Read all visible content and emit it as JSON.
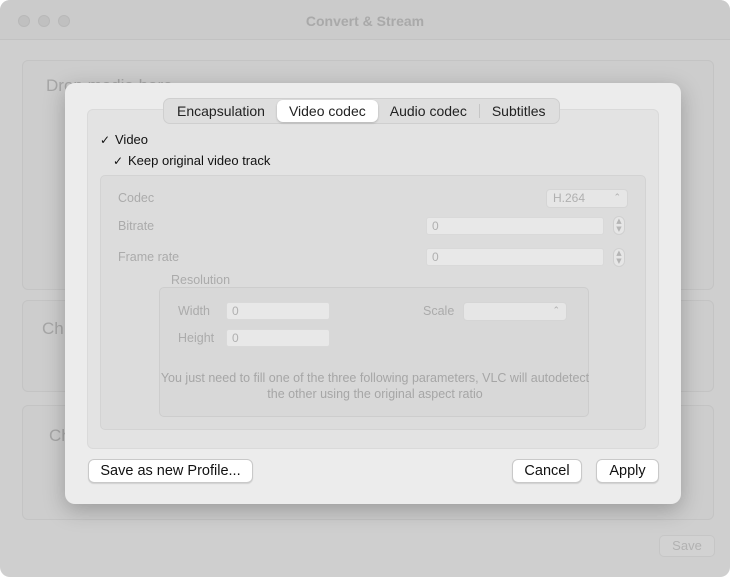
{
  "background_window": {
    "title": "Convert & Stream",
    "drop_text": "Drop media here",
    "section2_text": "Ch",
    "section3_text": "Ch",
    "save_label": "Save"
  },
  "tabs": [
    {
      "label": "Encapsulation",
      "active": false
    },
    {
      "label": "Video codec",
      "active": true
    },
    {
      "label": "Audio codec",
      "active": false
    },
    {
      "label": "Subtitles",
      "active": false
    }
  ],
  "video": {
    "video_checkbox": {
      "label": "Video",
      "checked": true
    },
    "keep_original_checkbox": {
      "label": "Keep original video track",
      "checked": true
    },
    "codec": {
      "label": "Codec",
      "value": "H.264"
    },
    "bitrate": {
      "label": "Bitrate",
      "value": "0"
    },
    "frame_rate": {
      "label": "Frame rate",
      "value": "0"
    },
    "resolution": {
      "title": "Resolution",
      "width": {
        "label": "Width",
        "value": "0"
      },
      "height": {
        "label": "Height",
        "value": "0"
      },
      "scale": {
        "label": "Scale",
        "value": ""
      },
      "hint": "You just need to fill one of the three following parameters, VLC will autodetect the other using the original aspect ratio"
    }
  },
  "buttons": {
    "save_profile": "Save as new Profile...",
    "cancel": "Cancel",
    "apply": "Apply"
  },
  "icons": {
    "checkmark": "✓",
    "stepper_up": "▲",
    "stepper_down": "▼",
    "popup_arrows": "⌃⌄"
  }
}
